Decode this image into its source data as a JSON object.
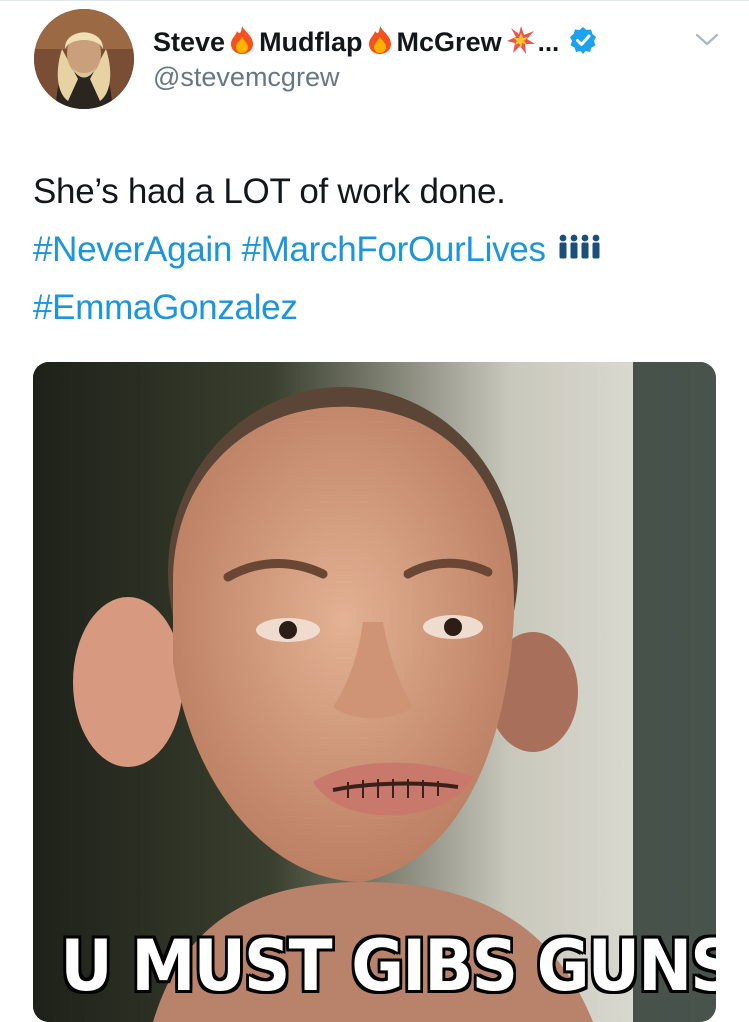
{
  "author": {
    "name_parts": [
      "Steve",
      "Mudflap",
      "McGrew"
    ],
    "name_ellipsis": "...",
    "handle": "@stevemcgrew",
    "verified": true
  },
  "emojis": [
    "fire-emoji",
    "fire-emoji",
    "collision-emoji"
  ],
  "tweet": {
    "line1": "She’s had a LOT of work done.",
    "hashtags": [
      "#NeverAgain",
      "#MarchForOurLives",
      "#EmmaGonzalez"
    ]
  },
  "media": {
    "caption": "U MUST GIBS GUNS"
  },
  "colors": {
    "link": "#1b95e0",
    "handle": "#657786",
    "verified": "#1da1f2",
    "fire": "#f4511e"
  }
}
